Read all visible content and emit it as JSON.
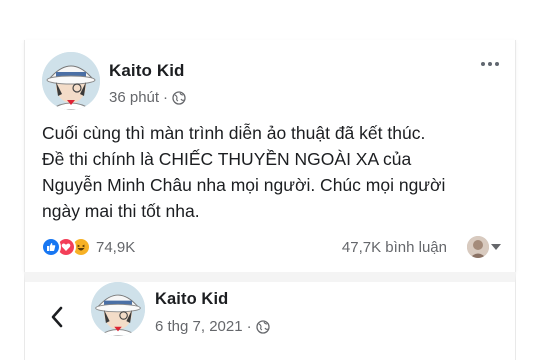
{
  "posts": [
    {
      "author": "Kaito Kid",
      "timestamp": "36 phút",
      "separator": "·",
      "privacy_icon": "globe-icon",
      "more_icon": "ellipsis-icon",
      "text": "Cuối cùng thì màn trình diễn ảo thuật đã kết thúc.\nĐề thi chính là CHIẾC THUYỀN NGOÀI XA của\nNguyễn Minh Châu nha mọi người. Chúc mọi người\nngày mai thi tốt nha.",
      "reactions": {
        "icons": [
          "like-icon",
          "love-icon",
          "haha-icon"
        ],
        "count": "74,9K"
      },
      "comments": "47,7K bình luận"
    },
    {
      "back_icon": "chevron-left-icon",
      "author": "Kaito Kid",
      "timestamp": "6 thg 7, 2021",
      "separator": "·",
      "privacy_icon": "globe-icon"
    }
  ],
  "colors": {
    "text": "#1c1e21",
    "secondary": "#65676b",
    "like": "#1877f2",
    "love": "#f33e58",
    "haha": "#f7b125"
  }
}
